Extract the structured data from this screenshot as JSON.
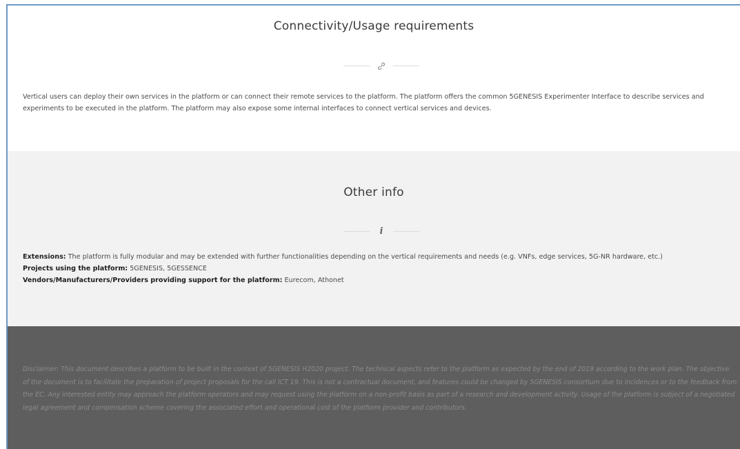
{
  "connectivity": {
    "title": "Connectivity/Usage requirements",
    "divider_icon": "link-icon",
    "text": "Vertical users can deploy their own services in the platform or can connect their remote services to the platform. The platform offers the common 5GENESIS Experimenter Interface to describe services and experiments to be executed in the platform. The platform may also expose some internal interfaces to connect vertical services and devices."
  },
  "other_info": {
    "title": "Other info",
    "divider_icon": "info-icon",
    "items": [
      {
        "label": "Extensions:",
        "value": " The platform is fully modular and may be extended with further functionalities depending on the vertical requirements and needs (e.g. VNFs, edge services, 5G-NR hardware, etc.)"
      },
      {
        "label": "Projects using the platform:",
        "value": " 5GENESIS, 5GESSENCE"
      },
      {
        "label": "Vendors/Manufacturers/Providers providing support for the platform:",
        "value": " Eurecom, Athonet"
      }
    ]
  },
  "footer": {
    "disclaimer": "Disclaimer: This document describes a platform to be built in the context of 5GENESIS H2020 project. The technical aspects refer to the platform as expected by the end of 2019 according to the work plan. The objective of the document is to facilitate the preparation of project proposals for the call ICT 19. This is not a contractual document, and features could be changed by 5GENESIS consortium due to incidences or to the feedback from the EC. Any interested entity may approach the platform operators and may request using the platform on a non-profit basis as part of a research and development activity. Usage of the platform is subject of a negotiated legal agreement and compensation scheme covering the associated effort and operational cost of the platform provider and contributors."
  },
  "colors": {
    "frame_border": "#6d97c6",
    "grey_section": "#f2f2f2",
    "footer_bg": "#5e5e5e"
  }
}
